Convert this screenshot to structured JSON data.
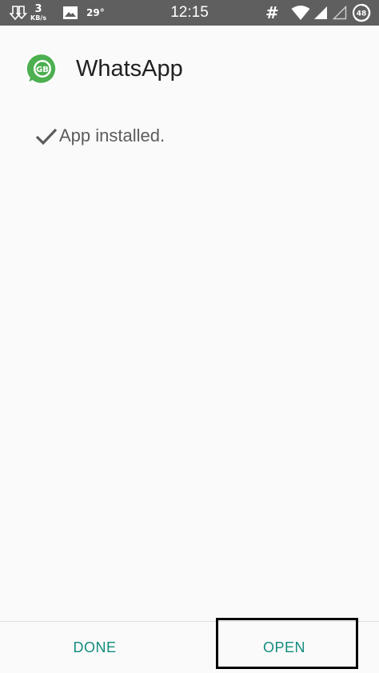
{
  "status_bar": {
    "net_speed": "3",
    "net_unit": "KB/s",
    "temperature": "29°",
    "time": "12:15",
    "hash": "#",
    "battery": "48"
  },
  "app": {
    "name": "WhatsApp",
    "icon_text": "GB",
    "install_message": "App installed."
  },
  "buttons": {
    "done_label": "DONE",
    "open_label": "OPEN"
  },
  "colors": {
    "status_bar_bg": "#5f5f5f",
    "background": "#fafafa",
    "accent": "#128c7e",
    "whatsapp_green": "#4caf50"
  }
}
